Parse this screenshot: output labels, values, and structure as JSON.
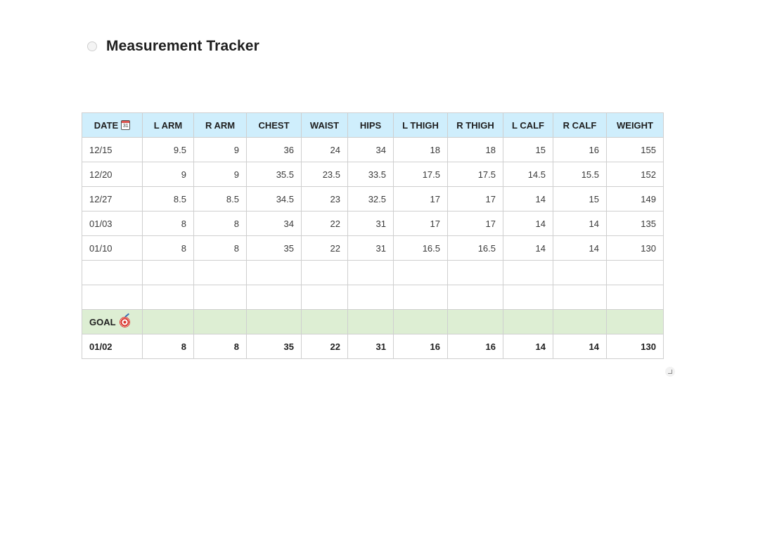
{
  "page": {
    "title": "Measurement Tracker"
  },
  "table": {
    "columns": [
      "DATE",
      "L ARM",
      "R ARM",
      "CHEST",
      "WAIST",
      "HIPS",
      "L THIGH",
      "R THIGH",
      "L CALF",
      "R CALF",
      "WEIGHT"
    ],
    "date_column_icon": "calendar-icon",
    "rows": [
      [
        "12/15",
        "9.5",
        "9",
        "36",
        "24",
        "34",
        "18",
        "18",
        "15",
        "16",
        "155"
      ],
      [
        "12/20",
        "9",
        "9",
        "35.5",
        "23.5",
        "33.5",
        "17.5",
        "17.5",
        "14.5",
        "15.5",
        "152"
      ],
      [
        "12/27",
        "8.5",
        "8.5",
        "34.5",
        "23",
        "32.5",
        "17",
        "17",
        "14",
        "15",
        "149"
      ],
      [
        "01/03",
        "8",
        "8",
        "34",
        "22",
        "31",
        "17",
        "17",
        "14",
        "14",
        "135"
      ],
      [
        "01/10",
        "8",
        "8",
        "35",
        "22",
        "31",
        "16.5",
        "16.5",
        "14",
        "14",
        "130"
      ],
      [
        "",
        "",
        "",
        "",
        "",
        "",
        "",
        "",
        "",
        "",
        ""
      ],
      [
        "",
        "",
        "",
        "",
        "",
        "",
        "",
        "",
        "",
        "",
        ""
      ]
    ],
    "goal_label": "GOAL",
    "goal_icon": "target-icon",
    "goal_row": [
      "01/02",
      "8",
      "8",
      "35",
      "22",
      "31",
      "16",
      "16",
      "14",
      "14",
      "130"
    ]
  },
  "colors": {
    "header_bg": "#cfeefc",
    "goal_bg": "#ddeed3",
    "border": "#cfcfcf"
  }
}
